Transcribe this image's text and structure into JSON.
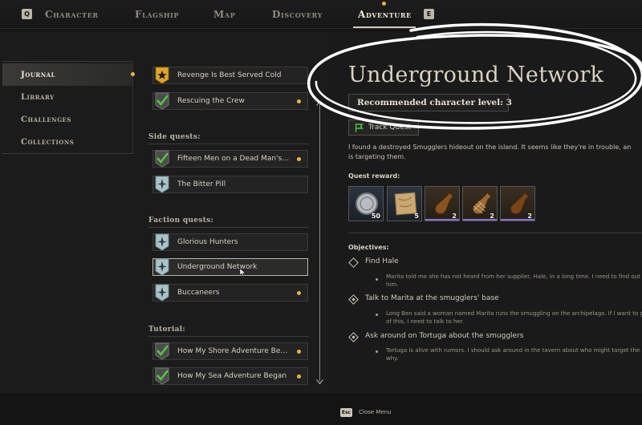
{
  "nav": {
    "left_key": "Q",
    "right_key": "E",
    "tabs": [
      {
        "label": "Character"
      },
      {
        "label": "Flagship"
      },
      {
        "label": "Map"
      },
      {
        "label": "Discovery"
      },
      {
        "label": "Adventure"
      }
    ],
    "active_tab": "Adventure"
  },
  "categories": [
    {
      "label": "Journal"
    },
    {
      "label": "Library"
    },
    {
      "label": "Challenges"
    },
    {
      "label": "Collections"
    }
  ],
  "quest_list": {
    "main": [
      {
        "label": "Revenge Is Best Served Cold",
        "icon": "gold-star-icon"
      },
      {
        "label": "Rescuing the Crew",
        "icon": "check-icon"
      }
    ],
    "side_label": "Side quests:",
    "side": [
      {
        "label": "Fifteen Men on a Dead Man's C...",
        "icon": "check-icon"
      },
      {
        "label": "The Bitter Pill",
        "icon": "compass-icon"
      }
    ],
    "faction_label": "Faction quests:",
    "faction": [
      {
        "label": "Glorious Hunters",
        "icon": "compass-icon"
      },
      {
        "label": "Underground Network",
        "icon": "compass-icon"
      },
      {
        "label": "Buccaneers",
        "icon": "compass-icon"
      }
    ],
    "tutorial_label": "Tutorial:",
    "tutorial": [
      {
        "label": "How My Shore Adventure Began",
        "icon": "check-icon"
      },
      {
        "label": "How My Sea Adventure Began",
        "icon": "check-icon"
      }
    ]
  },
  "detail": {
    "title": "Underground Network",
    "level_text": "Recommended character level: 3",
    "track_button": "Track Quest",
    "description_lines": [
      "I found a destroyed Smugglers hideout on the island. It seems like they're in trouble, an",
      "is targeting them."
    ],
    "reward_label": "Quest reward:",
    "rewards": [
      {
        "icon": "silver-coin-icon",
        "qty": "50"
      },
      {
        "icon": "treasure-map-icon",
        "qty": "5"
      },
      {
        "icon": "rum-bottle-icon",
        "qty": "2"
      },
      {
        "icon": "wrapped-bottle-icon",
        "qty": "2"
      },
      {
        "icon": "rum-bottle-icon",
        "qty": "2"
      }
    ],
    "objectives_label": "Objectives:",
    "objectives": [
      {
        "title": "Find Hale",
        "desc_lines": [
          "Marita told me she has not heard from her supplier, Hale, in a long time. I need to find out wha",
          "him."
        ]
      },
      {
        "title": "Talk to Marita at the smugglers' base",
        "desc_lines": [
          "Long Ben said a woman named Marita runs the smuggling on the archipelago. If I want to get t",
          "of this, I need to talk to her."
        ]
      },
      {
        "title": "Ask around on Tortuga about the smugglers",
        "desc_lines": [
          "Tortuga is alive with rumors. I should ask around in the tavern about who might target the smu",
          "why."
        ]
      }
    ]
  },
  "footer": {
    "esc_key": "Esc",
    "close_label": "Close Menu"
  },
  "colors": {
    "accent_dot": "#f2b33d",
    "check_green": "#58c24a",
    "annotation": "#ffffff"
  }
}
